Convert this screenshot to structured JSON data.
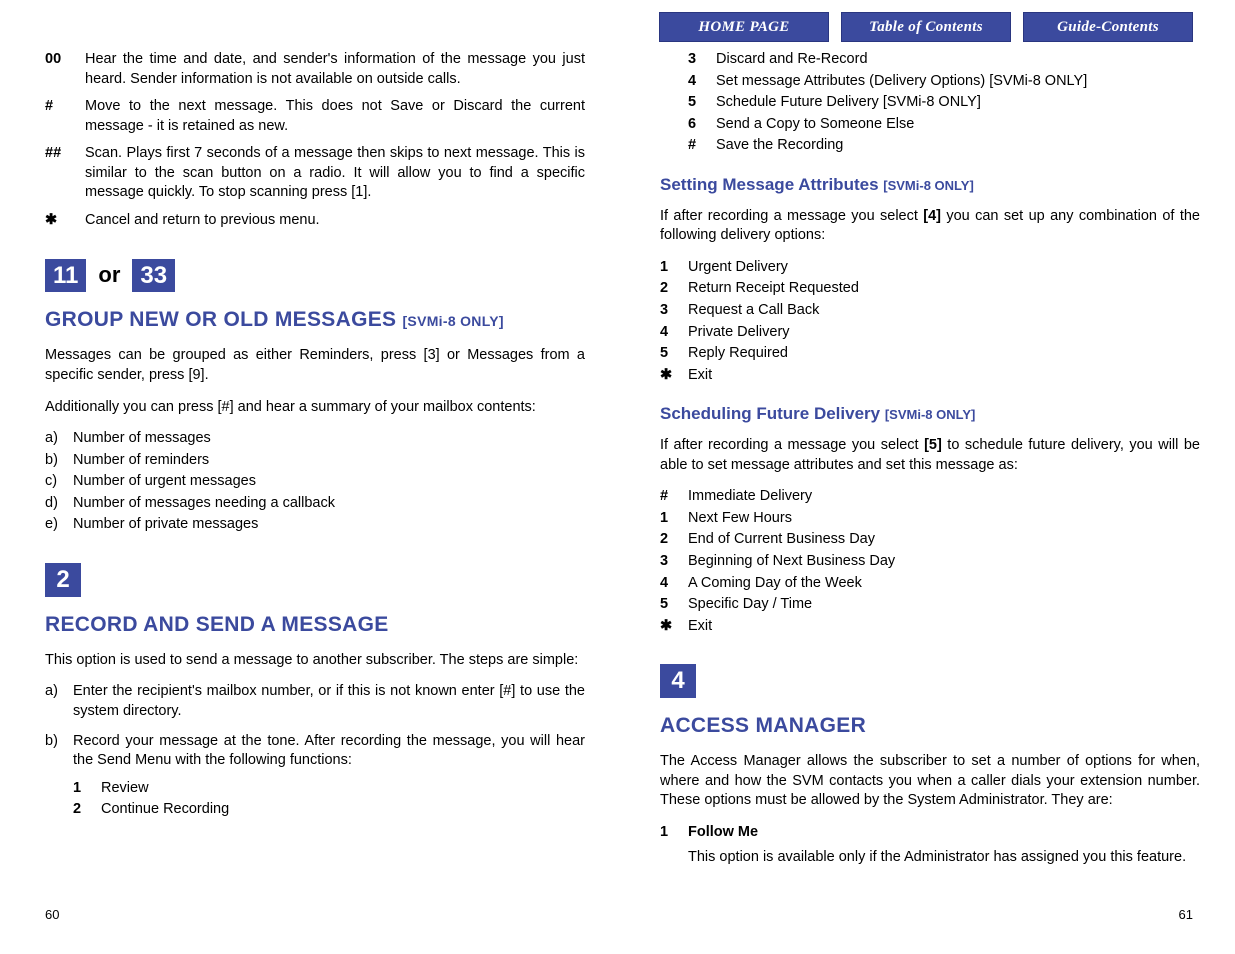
{
  "nav": {
    "home": "HOME PAGE",
    "toc": "Table of Contents",
    "guide": "Guide-Contents"
  },
  "left": {
    "keys": [
      {
        "k": "00",
        "d": "Hear the time and date, and sender's information of the message you just heard. Sender information is not available on outside calls."
      },
      {
        "k": "#",
        "d": "Move to the next message. This does not Save or Discard the current message - it is retained as new."
      },
      {
        "k": "##",
        "d": "Scan. Plays first 7 seconds of a message then skips to next message. This is similar to the scan button on a radio. It will allow you to find a specific message quickly. To stop scanning press [1]."
      },
      {
        "k": "✱",
        "d": "Cancel and return to previous menu."
      }
    ],
    "box11": "11",
    "or": "or",
    "box33": "33",
    "h_group": "GROUP NEW OR OLD MESSAGES",
    "h_group_sm": "[SVMi-8 ONLY]",
    "group_p1": "Messages can be grouped as either Reminders, press [3] or Messages from a specific sender, press [9].",
    "group_p2": "Additionally you can press [#] and hear a summary of your mailbox contents:",
    "group_list": [
      {
        "m": "a)",
        "d": "Number of messages"
      },
      {
        "m": "b)",
        "d": "Number of reminders"
      },
      {
        "m": "c)",
        "d": "Number of urgent messages"
      },
      {
        "m": "d)",
        "d": "Number of messages needing a callback"
      },
      {
        "m": "e)",
        "d": "Number of private messages"
      }
    ],
    "box2": "2",
    "h_record": "RECORD AND SEND A MESSAGE",
    "record_p1": "This option is used to send a message to another subscriber. The steps are simple:",
    "record_list": [
      {
        "m": "a)",
        "d": "Enter the recipient's mailbox number, or if this is not known enter [#] to use the system directory."
      },
      {
        "m": "b)",
        "d": "Record your message at the tone. After recording the message, you will hear the Send Menu with the following functions:"
      }
    ],
    "send_menu": [
      {
        "m": "1",
        "d": "Review"
      },
      {
        "m": "2",
        "d": "Continue Recording"
      }
    ],
    "pagenum": "60"
  },
  "right": {
    "send_menu_cont": [
      {
        "m": "3",
        "d": "Discard and Re-Record"
      },
      {
        "m": "4",
        "d": "Set message Attributes (Delivery Options) [SVMi-8 ONLY]"
      },
      {
        "m": "5",
        "d": "Schedule Future Delivery [SVMi-8 ONLY]"
      },
      {
        "m": "6",
        "d": "Send a Copy to Someone Else"
      },
      {
        "m": "#",
        "d": "Save the Recording"
      }
    ],
    "h_attrs": "Setting Message Attributes",
    "h_attrs_sm": "[SVMi-8 ONLY]",
    "attrs_p1a": "If after recording a message you select ",
    "attrs_p1b": "[4]",
    "attrs_p1c": " you can set up any combination of the following delivery options:",
    "attrs_list": [
      {
        "m": "1",
        "d": "Urgent Delivery"
      },
      {
        "m": "2",
        "d": "Return Receipt Requested"
      },
      {
        "m": "3",
        "d": "Request a Call Back"
      },
      {
        "m": "4",
        "d": "Private Delivery"
      },
      {
        "m": "5",
        "d": "Reply Required"
      },
      {
        "m": "✱",
        "d": "Exit"
      }
    ],
    "h_sched": "Scheduling Future Delivery",
    "h_sched_sm": "[SVMi-8 ONLY]",
    "sched_p1a": "If after recording a message you select ",
    "sched_p1b": "[5]",
    "sched_p1c": " to schedule future delivery, you will be able to set message attributes and set this message as:",
    "sched_list": [
      {
        "m": "#",
        "d": "Immediate Delivery"
      },
      {
        "m": "1",
        "d": "Next Few Hours"
      },
      {
        "m": "2",
        "d": "End of Current Business Day"
      },
      {
        "m": "3",
        "d": "Beginning of Next Business Day"
      },
      {
        "m": "4",
        "d": "A Coming Day of the Week"
      },
      {
        "m": "5",
        "d": "Specific Day / Time"
      },
      {
        "m": "✱",
        "d": "Exit"
      }
    ],
    "box4": "4",
    "h_access": "ACCESS MANAGER",
    "access_p1": "The Access Manager allows the subscriber to set a number of options for when, where and how the SVM contacts you when a caller dials your extension number. These options must be allowed by the System Administrator. They are:",
    "follow_num": "1",
    "follow_title": "Follow Me",
    "follow_desc": "This option is available only if the Administrator has assigned you this feature.",
    "pagenum": "61"
  }
}
